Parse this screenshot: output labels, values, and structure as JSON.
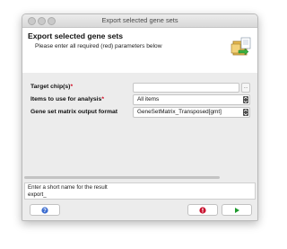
{
  "window": {
    "title": "Export selected gene sets"
  },
  "header": {
    "title": "Export selected gene sets",
    "subtitle": "Please enter all required (red) parameters below",
    "icon": "gene-set-export-icon"
  },
  "form": {
    "target_chips": {
      "label": "Target chip(s)",
      "required_mark": "*",
      "value": "",
      "browse_label": "..."
    },
    "items": {
      "label": "Items to use for analysis",
      "required_mark": "*",
      "value": "All items"
    },
    "format": {
      "label": "Gene set matrix output format",
      "value": "GeneSetMatrix_Transposed[gmt]"
    }
  },
  "result": {
    "prompt": "Enter a short name for the result",
    "value": "export_"
  },
  "buttons": {
    "help": "help-icon",
    "stop": "stop-icon",
    "run": "run-icon"
  },
  "colors": {
    "required": "#d0021b",
    "stop": "#c8102e",
    "run": "#1f9a2e",
    "help": "#3b6ccf"
  }
}
